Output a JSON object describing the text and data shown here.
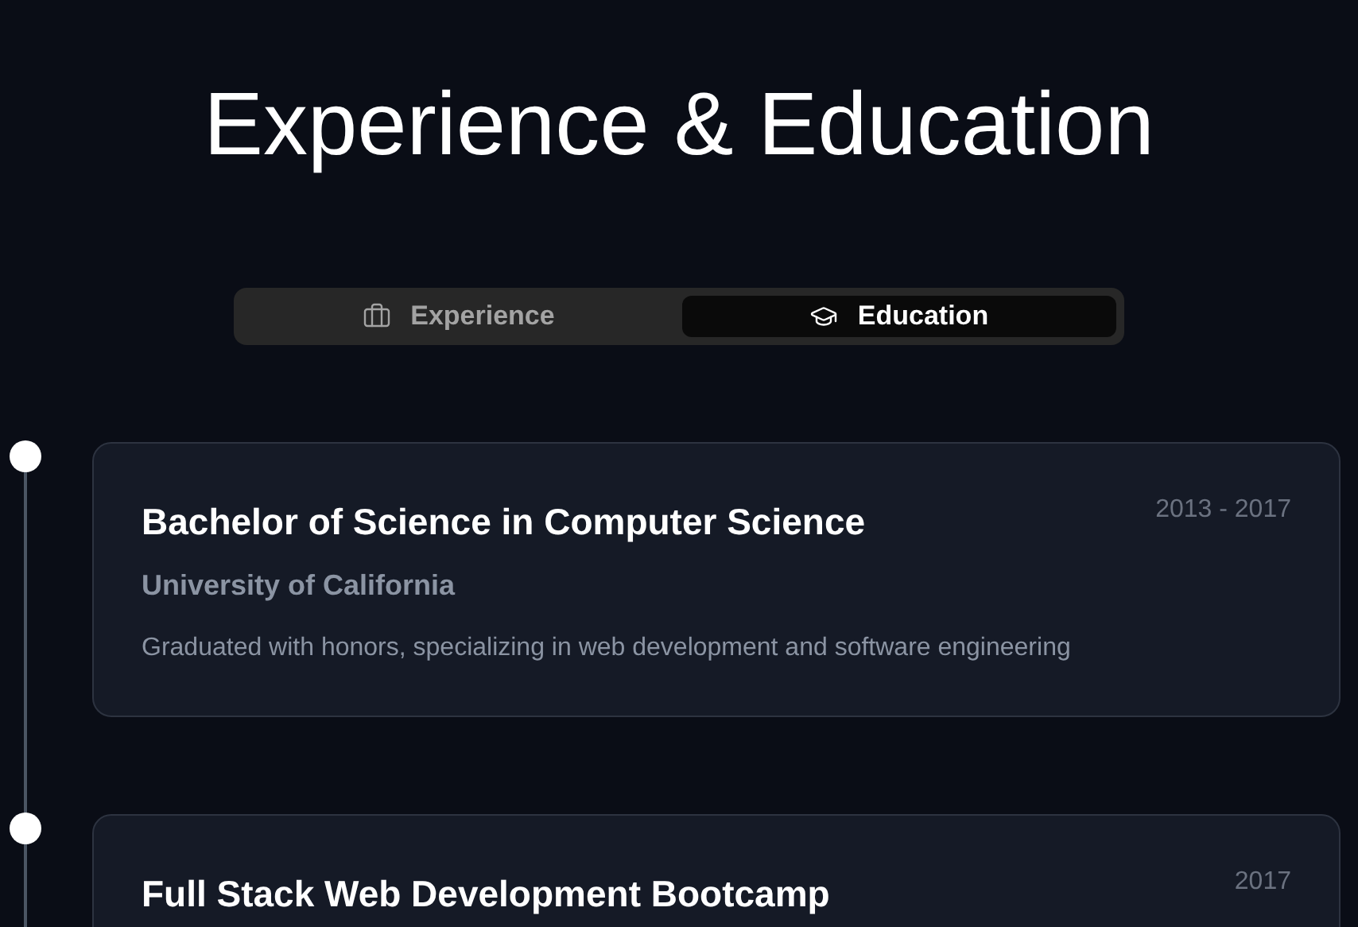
{
  "title": "Experience & Education",
  "tabs": [
    {
      "label": "Experience",
      "selected": false
    },
    {
      "label": "Education",
      "selected": true
    }
  ],
  "entries": [
    {
      "title": "Bachelor of Science in Computer Science",
      "dates": "2013 - 2017",
      "school": "University of California",
      "description": "Graduated with honors, specializing in web development and software engineering"
    },
    {
      "title": "Full Stack Web Development Bootcamp",
      "dates": "2017"
    }
  ]
}
